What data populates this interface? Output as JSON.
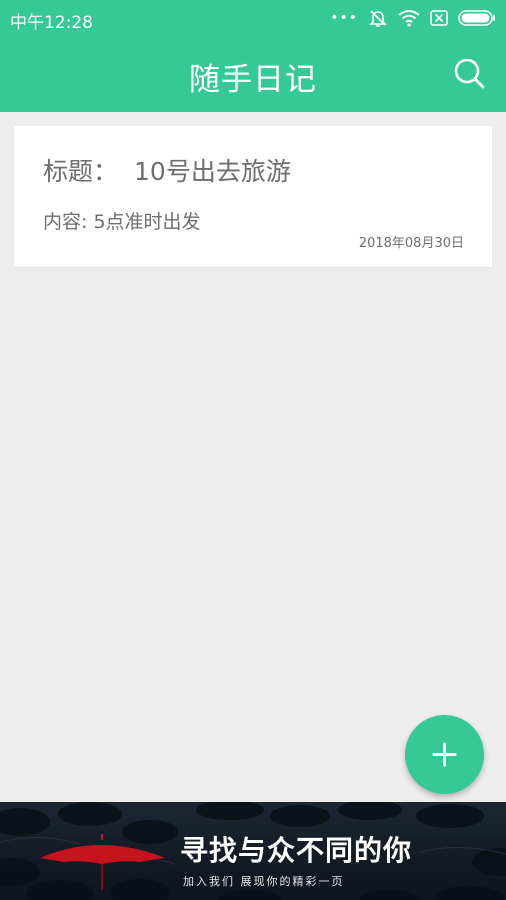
{
  "status_bar": {
    "time": "中午12:28",
    "icons": [
      "more-dots-icon",
      "alarm-off-icon",
      "wifi-icon",
      "sim-x-icon",
      "battery-icon"
    ]
  },
  "app_bar": {
    "title": "随手日记",
    "search_icon": "search-icon"
  },
  "diary_entries": [
    {
      "title_label": "标题：",
      "title": "10号出去旅游",
      "content_label": "内容:",
      "content": "5点准时出发",
      "date": "2018年08月30日"
    }
  ],
  "fab": {
    "icon": "plus-icon"
  },
  "ad_banner": {
    "headline": "寻找与众不同的你",
    "tagline": "加入我们  展现你的精彩一页"
  },
  "colors": {
    "accent": "#35c996",
    "background": "#ededed",
    "card": "#ffffff",
    "text_gray": "#6e6e6e"
  }
}
